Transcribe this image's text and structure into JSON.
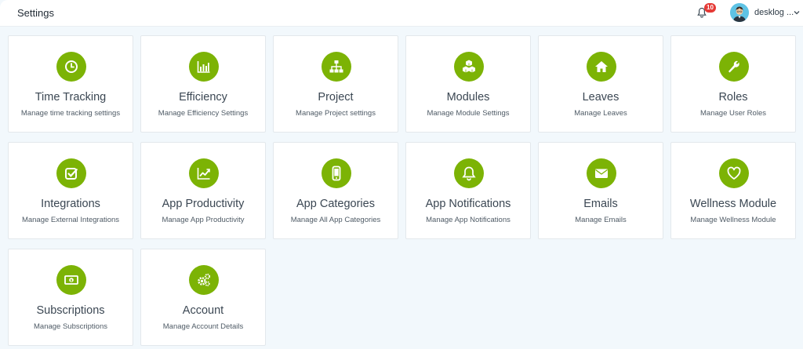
{
  "header": {
    "title": "Settings",
    "notification_count": "10",
    "user_name": "desklog ..."
  },
  "theme": {
    "accent": "#7cb305",
    "badge": "#e53935",
    "background": "#f2f8fc"
  },
  "cards": [
    {
      "title": "Time Tracking",
      "desc": "Manage time tracking settings",
      "icon": "clock-icon"
    },
    {
      "title": "Efficiency",
      "desc": "Manage Efficiency Settings",
      "icon": "bar-chart-icon"
    },
    {
      "title": "Project",
      "desc": "Manage Project settings",
      "icon": "sitemap-icon"
    },
    {
      "title": "Modules",
      "desc": "Manage Module Settings",
      "icon": "cubes-icon"
    },
    {
      "title": "Leaves",
      "desc": "Manage Leaves",
      "icon": "home-icon"
    },
    {
      "title": "Roles",
      "desc": "Manage User Roles",
      "icon": "wrench-icon"
    },
    {
      "title": "Integrations",
      "desc": "Manage External Integrations",
      "icon": "check-square-icon"
    },
    {
      "title": "App Productivity",
      "desc": "Manage App Productivity",
      "icon": "line-chart-icon"
    },
    {
      "title": "App Categories",
      "desc": "Manage All App Categories",
      "icon": "mobile-icon"
    },
    {
      "title": "App Notifications",
      "desc": "Manage App Notifications",
      "icon": "bell-icon"
    },
    {
      "title": "Emails",
      "desc": "Manage Emails",
      "icon": "envelope-icon"
    },
    {
      "title": "Wellness Module",
      "desc": "Manage Wellness Module",
      "icon": "heart-icon"
    },
    {
      "title": "Subscriptions",
      "desc": "Manage Subscriptions",
      "icon": "money-icon"
    },
    {
      "title": "Account",
      "desc": "Manage Account Details",
      "icon": "cogs-icon"
    }
  ]
}
